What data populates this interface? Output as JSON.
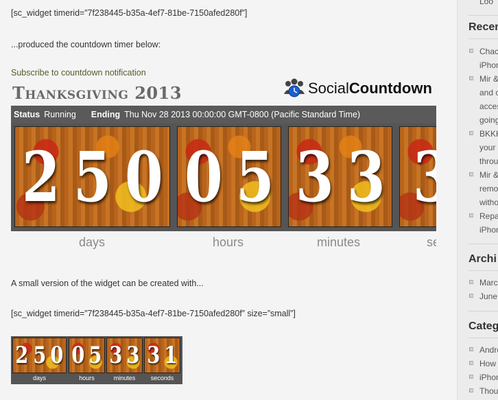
{
  "content": {
    "shortcode_large": "[sc_widget timerid=”7f238445-b35a-4ef7-81be-7150afed280f”]",
    "produced_text": "...produced the countdown timer below:",
    "subscribe_link": "Subscribe to countdown notification",
    "small_version_text": "A small version of the widget can be created with...",
    "shortcode_small": "[sc_widget timerid=”7f238445-b35a-4ef7-81be-7150afed280f” size=”small”]"
  },
  "widget": {
    "title_word": "Thanksgiving",
    "title_year": "2013",
    "brand_social": "Social",
    "brand_countdown": "Countdown",
    "status_label": "Status",
    "status_value": "Running",
    "ending_label": "Ending",
    "ending_value": "Thu Nov 28 2013 00:00:00 GMT-0800 (Pacific Standard Time)",
    "groups": [
      {
        "digits": [
          "2",
          "5",
          "0"
        ],
        "label": "days"
      },
      {
        "digits": [
          "0",
          "5"
        ],
        "label": "hours"
      },
      {
        "digits": [
          "3",
          "3"
        ],
        "label": "minutes"
      },
      {
        "digits": [
          "3"
        ],
        "label": "se"
      }
    ]
  },
  "small_widget": {
    "groups": [
      {
        "digits": [
          "2",
          "5",
          "0"
        ],
        "label": "days"
      },
      {
        "digits": [
          "0",
          "5"
        ],
        "label": "hours"
      },
      {
        "digits": [
          "3",
          "3"
        ],
        "label": "minutes"
      },
      {
        "digits": [
          "3",
          "1"
        ],
        "label": "seconds"
      }
    ]
  },
  "sidebar": {
    "top_fragment": "Loo",
    "recent_heading": "Recen",
    "recent_items": [
      "Chaci",
      "iPhon",
      "Mir &",
      "and c",
      "acces",
      "going",
      "BKKK",
      "your",
      "throu",
      "Mir &",
      "remo",
      "witho",
      "Repa",
      "iPhon"
    ],
    "archives_heading": "Archi",
    "archive_items": [
      "March",
      "June"
    ],
    "categories_heading": "Categ",
    "category_items": [
      "Andro",
      "How",
      "iPhon",
      "Thou"
    ]
  },
  "colors": {
    "page_bg": "#f4f4f4",
    "sidebar_bg": "#ececec",
    "panel_bg": "#555555",
    "link": "#5a5a2e",
    "title_gray": "#6a6a6a",
    "digit_white": "#ffffff"
  },
  "icons": {
    "brand_logo": "people-clock-icon",
    "sidebar_bullet": "square-bullet-icon"
  }
}
